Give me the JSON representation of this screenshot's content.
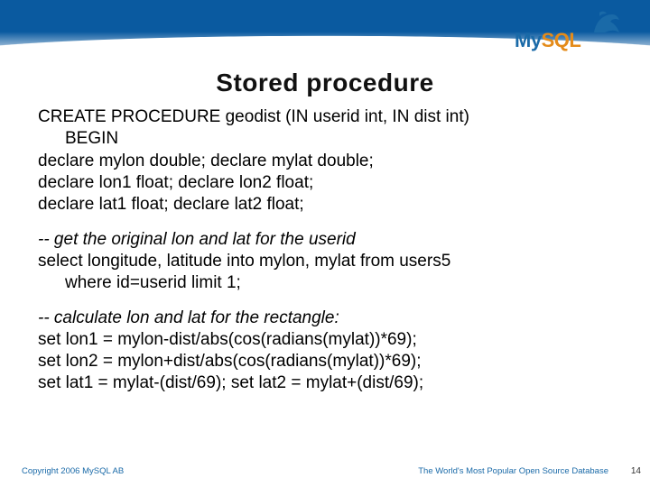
{
  "logo": {
    "my": "My",
    "sql": "SQL"
  },
  "title": "Stored procedure",
  "code": {
    "block1_l1": "CREATE PROCEDURE geodist (IN userid int, IN dist int)",
    "block1_l2": "BEGIN",
    "block1_l3": "declare mylon double;  declare mylat double;",
    "block1_l4": "declare lon1 float;  declare lon2 float;",
    "block1_l5": "declare lat1 float; declare lat2 float;",
    "block2_l1": "-- get the original lon and lat for the userid",
    "block2_l2": "select longitude, latitude into mylon, mylat from users5",
    "block2_l3": "where id=userid limit 1;",
    "block3_l1": "-- calculate lon and lat for the rectangle:",
    "block3_l2": "set lon1 = mylon-dist/abs(cos(radians(mylat))*69);",
    "block3_l3": "set lon2 = mylon+dist/abs(cos(radians(mylat))*69);",
    "block3_l4": "set lat1 = mylat-(dist/69);  set lat2 = mylat+(dist/69);"
  },
  "footer": {
    "left": "Copyright 2006 MySQL AB",
    "right": "The World's Most Popular Open Source Database",
    "page": "14"
  }
}
